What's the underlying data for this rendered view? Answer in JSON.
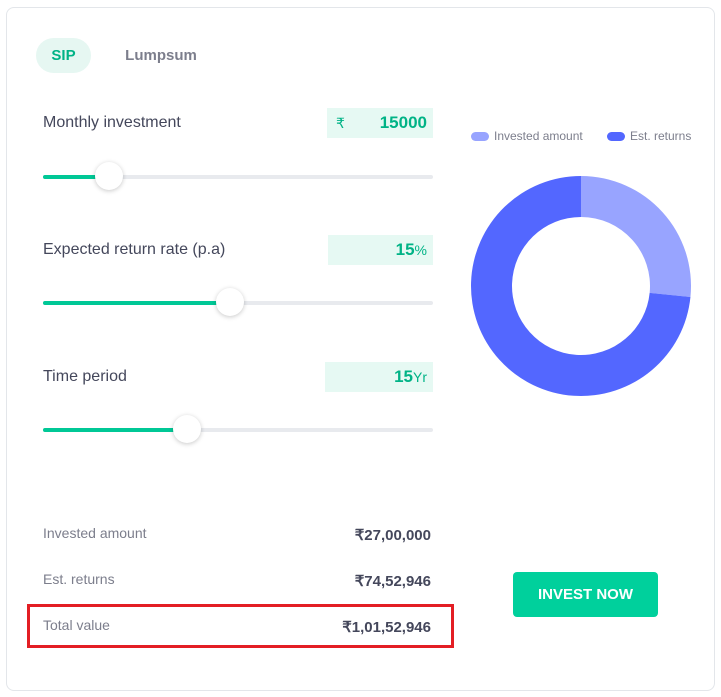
{
  "tabs": [
    {
      "label": "SIP",
      "active": true
    },
    {
      "label": "Lumpsum",
      "active": false
    }
  ],
  "inputs": {
    "monthly_investment": {
      "label": "Monthly investment",
      "currency_symbol": "₹",
      "value": "15000",
      "slider_fraction": 0.17
    },
    "return_rate": {
      "label": "Expected return rate (p.a)",
      "value": "15",
      "unit": "%",
      "slider_fraction": 0.48
    },
    "time_period": {
      "label": "Time period",
      "value": "15",
      "unit": "Yr",
      "slider_fraction": 0.37
    }
  },
  "chart_data": {
    "type": "pie",
    "donut": true,
    "categories": [
      "Invested amount",
      "Est. returns"
    ],
    "values": [
      2700000,
      7452946
    ],
    "colors": [
      "#98a4ff",
      "#5367ff"
    ],
    "legend_position": "top"
  },
  "summary": {
    "invested_label": "Invested amount",
    "invested_value": "₹27,00,000",
    "returns_label": "Est. returns",
    "returns_value": "₹74,52,946",
    "total_label": "Total value",
    "total_value": "₹1,01,52,946"
  },
  "cta": {
    "label": "INVEST NOW"
  },
  "colors": {
    "accent": "#00d09c",
    "invested": "#98a4ff",
    "returns": "#5367ff",
    "highlight": "#e31e24"
  }
}
